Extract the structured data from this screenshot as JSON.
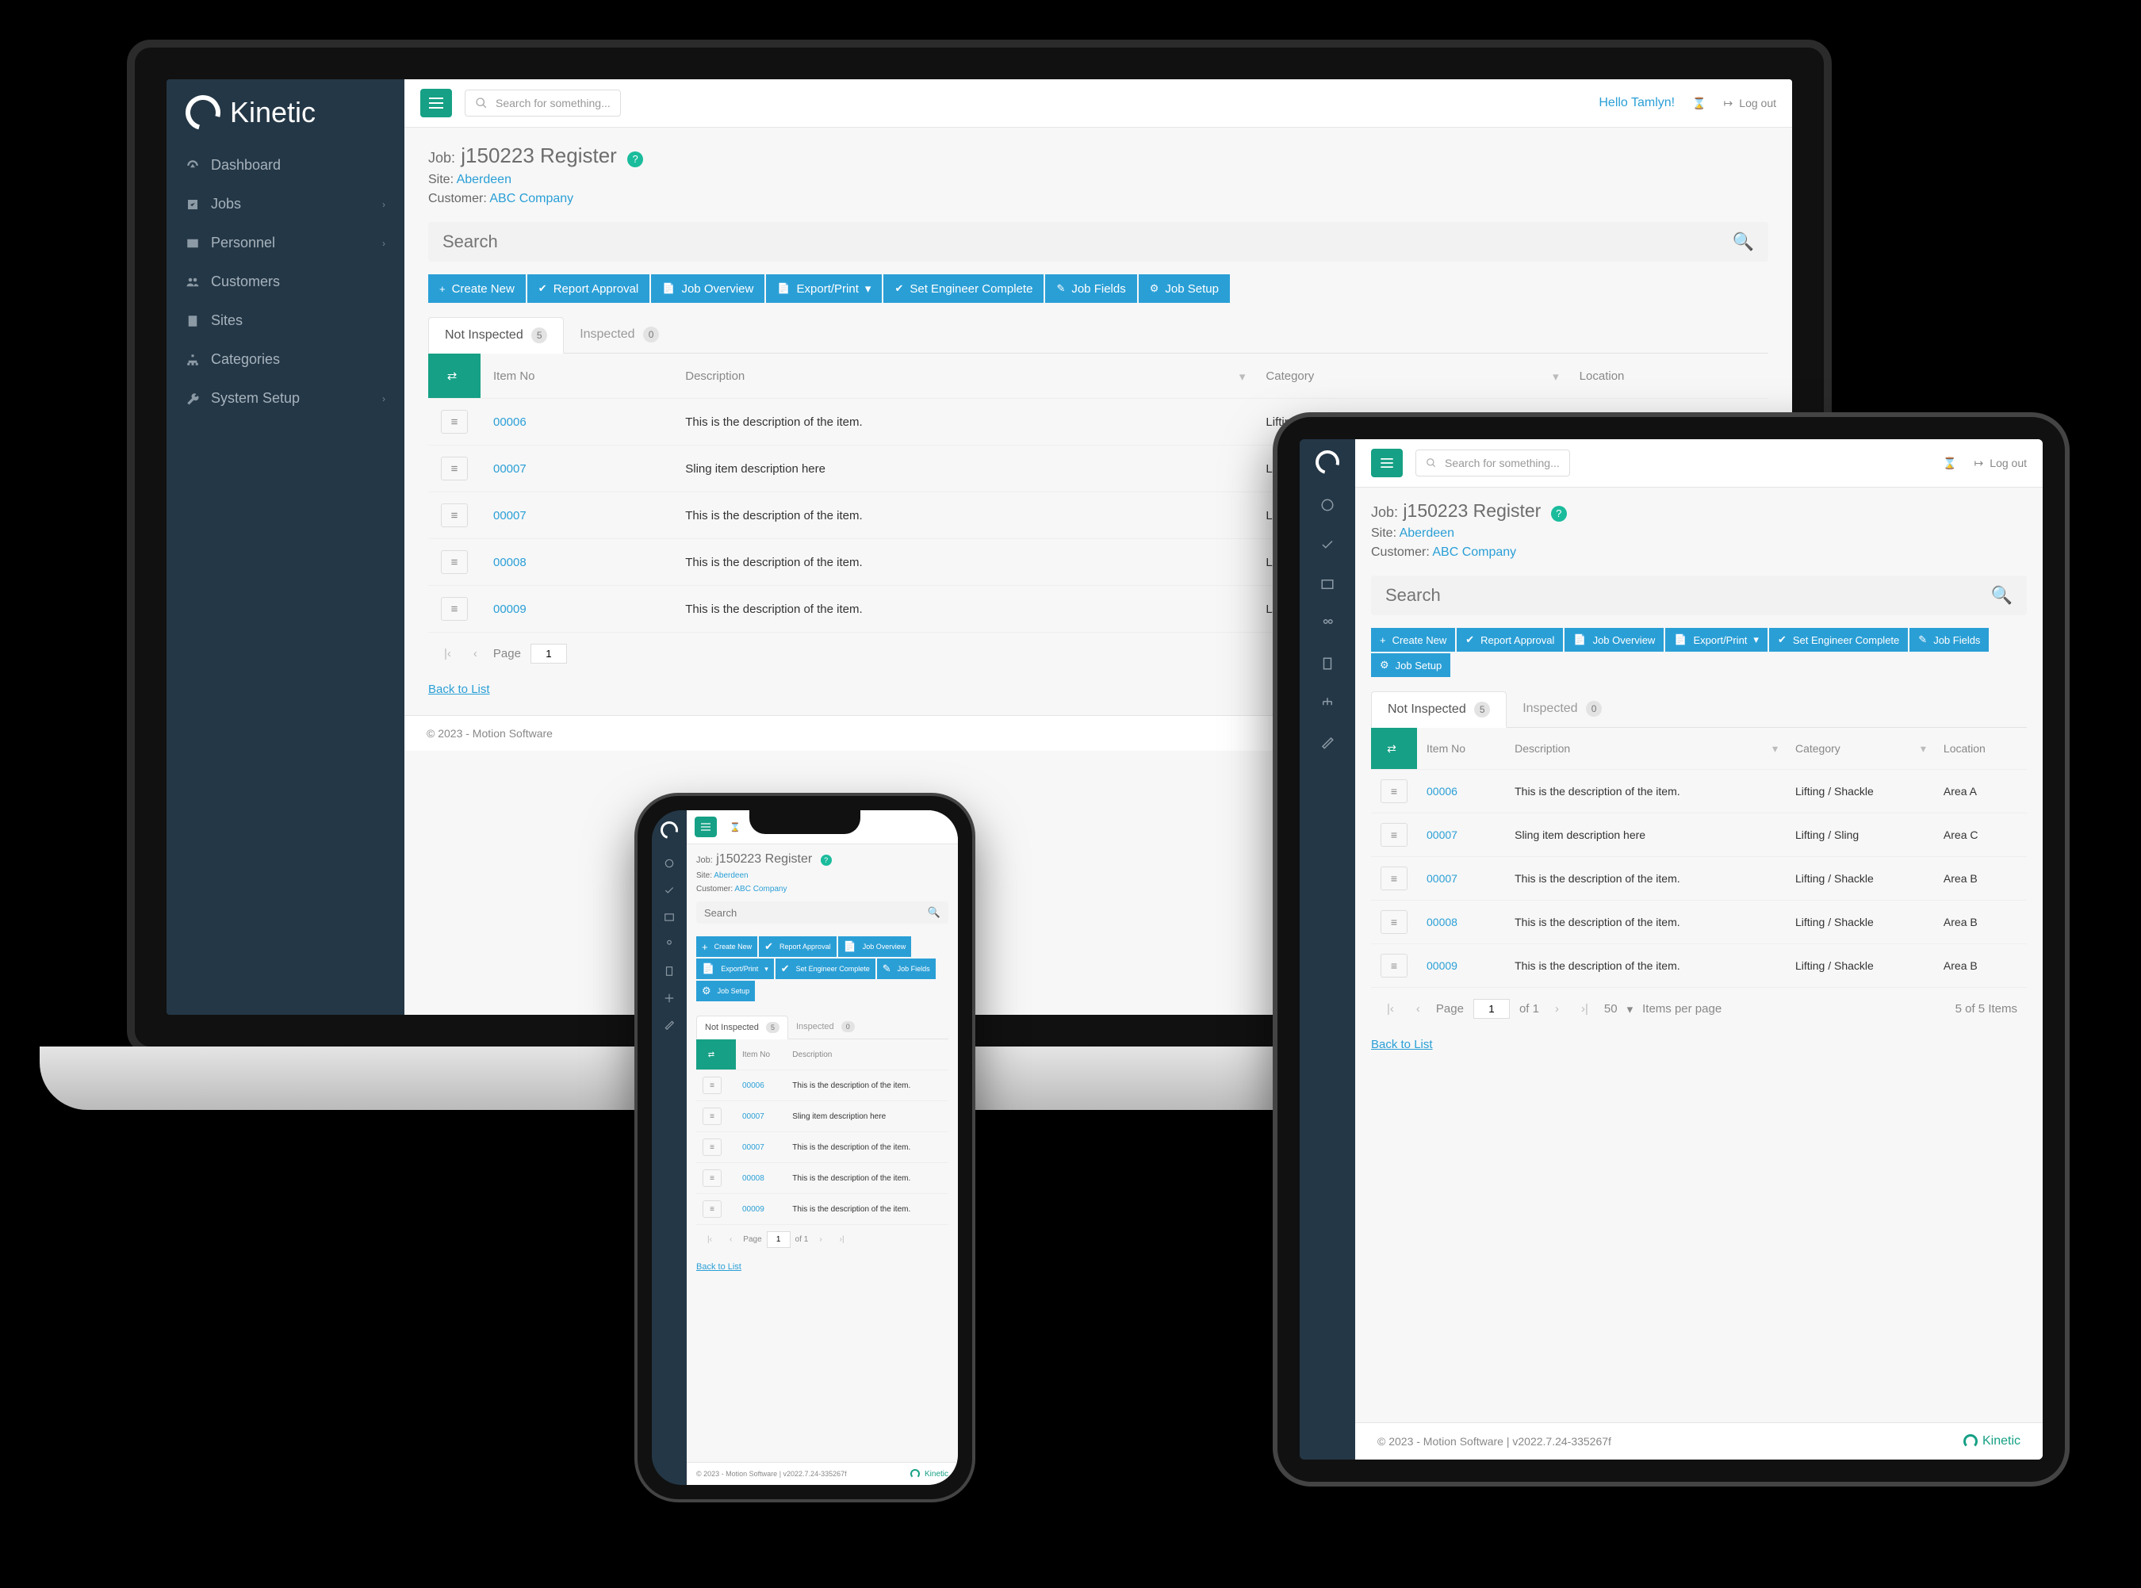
{
  "brand": "Kinetic",
  "sidebar": {
    "items": [
      {
        "label": "Dashboard",
        "icon": "gauge"
      },
      {
        "label": "Jobs",
        "icon": "check",
        "expandable": true
      },
      {
        "label": "Personnel",
        "icon": "idcard",
        "expandable": true
      },
      {
        "label": "Customers",
        "icon": "users"
      },
      {
        "label": "Sites",
        "icon": "building"
      },
      {
        "label": "Categories",
        "icon": "sitemap"
      },
      {
        "label": "System Setup",
        "icon": "wrench",
        "expandable": true
      }
    ]
  },
  "topbar": {
    "search_placeholder": "Search for something...",
    "hello": "Hello Tamlyn!",
    "logout": "Log out"
  },
  "page": {
    "job_label": "Job:",
    "job_title": "j150223 Register",
    "site_label": "Site:",
    "site_value": "Aberdeen",
    "customer_label": "Customer:",
    "customer_value": "ABC Company",
    "search_placeholder": "Search",
    "back": "Back to List"
  },
  "actions": [
    {
      "icon": "+",
      "label": "Create New"
    },
    {
      "icon": "✔",
      "label": "Report Approval"
    },
    {
      "icon": "📄",
      "label": "Job Overview"
    },
    {
      "icon": "📄",
      "label": "Export/Print",
      "caret": true
    },
    {
      "icon": "✔",
      "label": "Set Engineer Complete"
    },
    {
      "icon": "✎",
      "label": "Job Fields"
    },
    {
      "icon": "⚙",
      "label": "Job Setup"
    }
  ],
  "tabs": {
    "not_inspected": "Not Inspected",
    "not_inspected_count": "5",
    "inspected": "Inspected",
    "inspected_count": "0"
  },
  "columns": {
    "item_no": "Item No",
    "description": "Description",
    "category": "Category",
    "location": "Location"
  },
  "rows": [
    {
      "id": "00006",
      "desc": "This is the description of the item.",
      "cat": "Lifting / Shackle",
      "loc": "Area A"
    },
    {
      "id": "00007",
      "desc": "Sling item description here",
      "cat": "Lifting / Sling",
      "loc": "Area C"
    },
    {
      "id": "00007",
      "desc": "This is the description of the item.",
      "cat": "Lifting / Shackle",
      "loc": "Area B"
    },
    {
      "id": "00008",
      "desc": "This is the description of the item.",
      "cat": "Lifting / Shackle",
      "loc": "Area B"
    },
    {
      "id": "00009",
      "desc": "This is the description of the item.",
      "cat": "Lifting / Shackle",
      "loc": "Area B"
    }
  ],
  "pager": {
    "page_label": "Page",
    "page": "1",
    "of_label": "of 1",
    "size": "50",
    "ipp": "Items per page",
    "total": "5 of 5 Items"
  },
  "footer": {
    "copyright": "© 2023 - Motion Software",
    "version": "v2022.7.24-335267f"
  }
}
